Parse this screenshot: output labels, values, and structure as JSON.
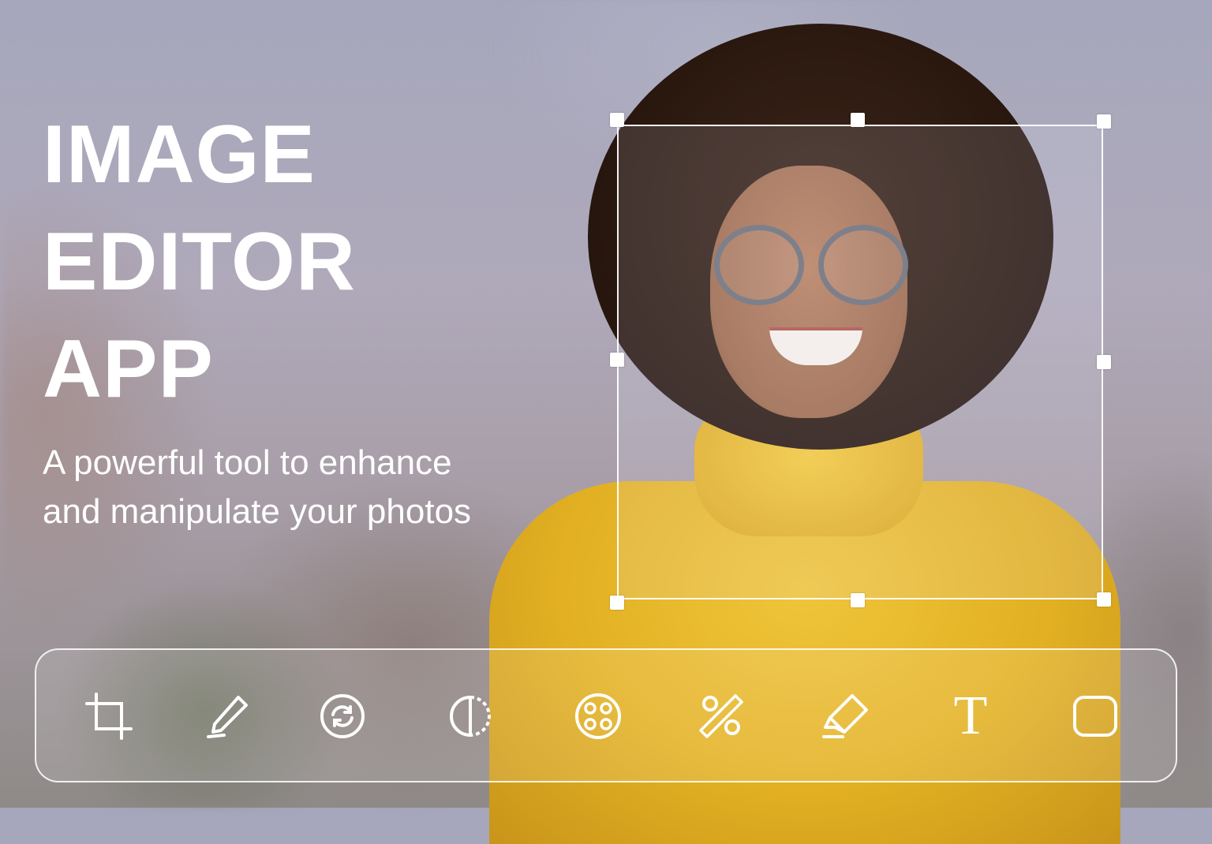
{
  "hero": {
    "title_lines": [
      "IMAGE",
      "EDITOR",
      "APP"
    ],
    "subtitle_lines": [
      "A powerful tool to enhance",
      "and manipulate your photos"
    ]
  },
  "toolbar": {
    "tools": [
      {
        "name": "crop-icon"
      },
      {
        "name": "brush-icon"
      },
      {
        "name": "rotate-icon"
      },
      {
        "name": "contrast-icon"
      },
      {
        "name": "filters-icon"
      },
      {
        "name": "adjust-percent-icon"
      },
      {
        "name": "eraser-icon"
      },
      {
        "name": "text-tool-icon",
        "glyph": "T"
      },
      {
        "name": "shape-icon"
      }
    ]
  },
  "colors": {
    "accent": "#ffffff",
    "sweater": "#e2b022"
  }
}
